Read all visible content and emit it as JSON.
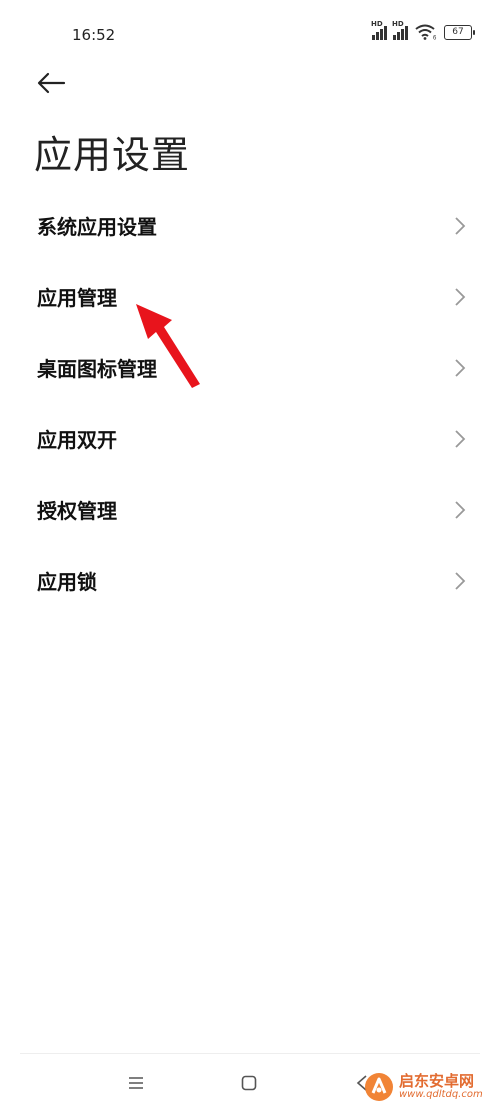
{
  "status_bar": {
    "time": "16:52",
    "signal1_label": "HD",
    "signal2_label": "HD",
    "wifi_label": "6",
    "battery": "67"
  },
  "header": {
    "back_icon": "arrow-left-icon",
    "title": "应用设置"
  },
  "menu": {
    "items": [
      {
        "label": "系统应用设置"
      },
      {
        "label": "应用管理"
      },
      {
        "label": "桌面图标管理"
      },
      {
        "label": "应用双开"
      },
      {
        "label": "授权管理"
      },
      {
        "label": "应用锁"
      }
    ]
  },
  "annotation": {
    "arrow_color": "#e8141c"
  },
  "nav_bar": {
    "menu_icon": "menu-lines-icon",
    "home_icon": "square-home-icon",
    "back_icon": "triangle-back-icon"
  },
  "watermark": {
    "title": "启东安卓网",
    "url": "www.qdltdq.com"
  }
}
